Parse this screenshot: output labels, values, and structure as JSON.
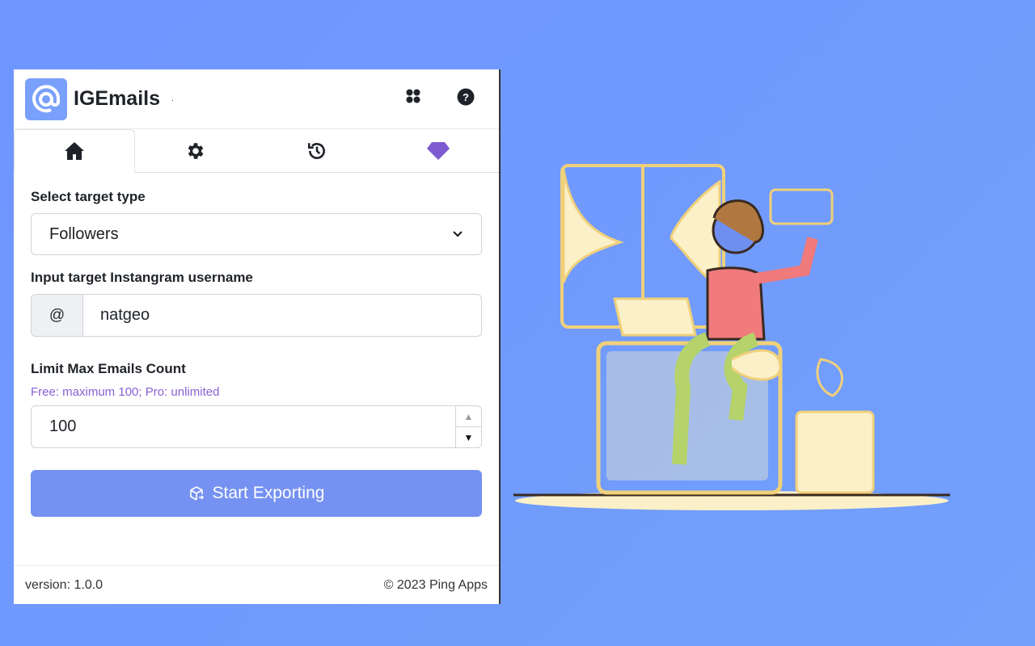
{
  "app": {
    "title": "IGEmails",
    "dot": "."
  },
  "header": {
    "icons": [
      "apps-icon",
      "help-icon"
    ]
  },
  "tabs": [
    {
      "name": "home",
      "icon": "home-icon"
    },
    {
      "name": "settings",
      "icon": "gear-icon"
    },
    {
      "name": "history",
      "icon": "history-icon"
    },
    {
      "name": "pro",
      "icon": "diamond-icon"
    }
  ],
  "form": {
    "target_type_label": "Select target type",
    "target_type_value": "Followers",
    "username_label": "Input target Instangram username",
    "username_prefix": "@",
    "username_value": "natgeo",
    "limit_label": "Limit Max Emails Count",
    "limit_hint": "Free: maximum 100; Pro: unlimited",
    "limit_value": "100",
    "start_button": "Start Exporting"
  },
  "footer": {
    "version": "version: 1.0.0",
    "copyright": "© 2023 Ping Apps"
  },
  "colors": {
    "accent": "#7591f1",
    "pro": "#8a5fd6",
    "background": "#6f95ff"
  }
}
